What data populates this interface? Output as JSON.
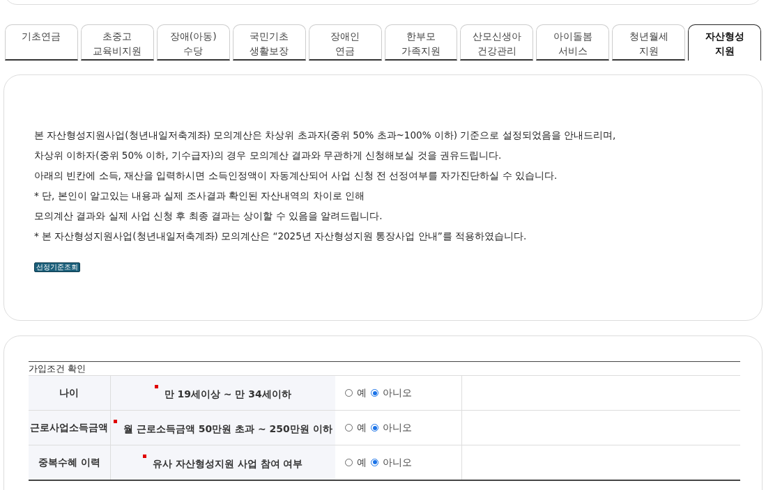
{
  "tabs": [
    {
      "lines": [
        "기초연금"
      ],
      "selected": false
    },
    {
      "lines": [
        "초중고",
        "교육비지원"
      ],
      "selected": false
    },
    {
      "lines": [
        "장애(아동)",
        "수당"
      ],
      "selected": false
    },
    {
      "lines": [
        "국민기초",
        "생활보장"
      ],
      "selected": false
    },
    {
      "lines": [
        "장애인",
        "연금"
      ],
      "selected": false
    },
    {
      "lines": [
        "한부모",
        "가족지원"
      ],
      "selected": false
    },
    {
      "lines": [
        "산모신생아",
        "건강관리"
      ],
      "selected": false
    },
    {
      "lines": [
        "아이돌봄",
        "서비스"
      ],
      "selected": false
    },
    {
      "lines": [
        "청년월세",
        "지원"
      ],
      "selected": false
    },
    {
      "lines": [
        "자산형성",
        "지원"
      ],
      "selected": true
    }
  ],
  "notice": {
    "lines": [
      "본 자산형성지원사업(청년내일저축계좌) 모의계산은 차상위 초과자(중위 50% 초과~100% 이하) 기준으로 설정되었음을 안내드리며,",
      "차상위 이하자(중위 50% 이하, 기수급자)의 경우 모의계산 결과와 무관하게 신청해보실 것을 권유드립니다.",
      "아래의 빈칸에 소득, 재산을 입력하시면 소득인정액이 자동계산되어 사업 신청 전 선정여부를 자가진단하실 수 있습니다.",
      "* 단, 본인이 알고있는 내용과 실제 조사결과 확인된 자산내역의 차이로 인해",
      "모의계산 결과와 실제 사업 신청 후 최종 결과는 상이할 수 있음을 알려드립니다.",
      "* 본 자산형성지원사업(청년내일저축계좌) 모의계산은 “2025년 자산형성지원 통장사업 안내”를 적용하였습니다."
    ],
    "button": "선정기준조회"
  },
  "table": {
    "caption": "가입조건 확인",
    "rows": [
      {
        "label": "나이",
        "condition": "만 19세이상 ~ 만 34세이하",
        "options": [
          {
            "label": "예",
            "selected": false
          },
          {
            "label": "아니오",
            "selected": true
          }
        ]
      },
      {
        "label": "근로사업소득금액",
        "condition": "월 근로소득금액 50만원 초과 ~ 250만원 이하",
        "options": [
          {
            "label": "예",
            "selected": false
          },
          {
            "label": "아니오",
            "selected": true
          }
        ]
      },
      {
        "label": "중복수혜 이력",
        "condition": "유사 자산형성지원 사업 참여 여부",
        "options": [
          {
            "label": "예",
            "selected": false
          },
          {
            "label": "아니오",
            "selected": true
          }
        ]
      }
    ]
  }
}
